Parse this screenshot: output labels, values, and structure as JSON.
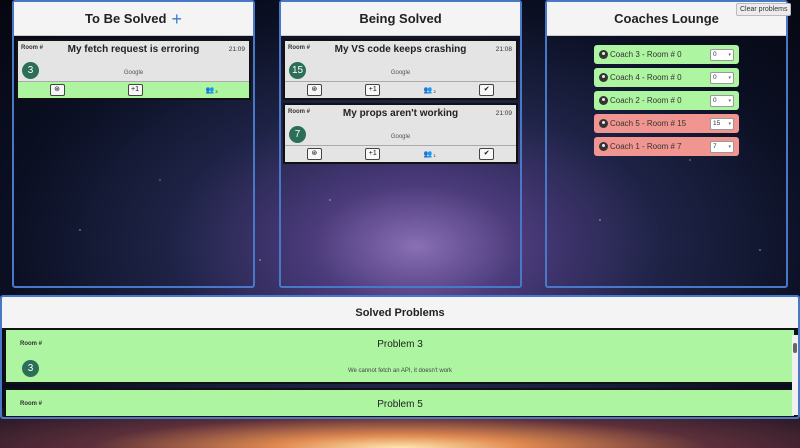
{
  "columns": {
    "to_be_solved": {
      "title": "To Be Solved",
      "add_icon": "plus-icon",
      "cards": [
        {
          "room_label": "Room #",
          "title": "My fetch request is erroring",
          "time": "21:09",
          "room": "3",
          "company": "Google",
          "actions": {
            "help_icon": "lifebuoy-icon",
            "plus_one": "+1",
            "group_icon": "group-icon",
            "count": "3"
          }
        }
      ]
    },
    "being_solved": {
      "title": "Being Solved",
      "cards": [
        {
          "room_label": "Room #",
          "title": "My VS code keeps crashing",
          "time": "21:08",
          "room": "15",
          "company": "Google",
          "actions": {
            "help_icon": "lifebuoy-icon",
            "plus_one": "+1",
            "group_icon": "group-icon",
            "count": "2",
            "done_icon": "checkmark-icon"
          }
        },
        {
          "room_label": "Room #",
          "title": "My props aren't working",
          "time": "21:09",
          "room": "7",
          "company": "Google",
          "actions": {
            "help_icon": "lifebuoy-icon",
            "plus_one": "+1",
            "group_icon": "group-icon",
            "count": "1",
            "done_icon": "checkmark-icon"
          }
        }
      ]
    },
    "coaches_lounge": {
      "title": "Coaches Lounge",
      "clear_label": "Clear problems",
      "coaches": [
        {
          "label": "Coach 3 - Room # 0",
          "selected": "0",
          "status": "available",
          "color": "#adf5a0"
        },
        {
          "label": "Coach 4 - Room # 0",
          "selected": "0",
          "status": "available",
          "color": "#adf5a0"
        },
        {
          "label": "Coach 2 - Room # 0",
          "selected": "0",
          "status": "available",
          "color": "#adf5a0"
        },
        {
          "label": "Coach 5 - Room # 15",
          "selected": "15",
          "status": "busy",
          "color": "#f0958f"
        },
        {
          "label": "Coach 1 - Room # 7",
          "selected": "7",
          "status": "busy",
          "color": "#f0958f"
        }
      ]
    }
  },
  "solved": {
    "title": "Solved Problems",
    "items": [
      {
        "room_label": "Room #",
        "title": "Problem 3",
        "room": "3",
        "description": "We cannot fetch an API, it doesn't work"
      },
      {
        "room_label": "Room #",
        "title": "Problem 5"
      }
    ]
  },
  "colors": {
    "accent": "#4a78c8",
    "available": "#adf5a0",
    "busy": "#f0958f",
    "badge": "#2c6e58"
  }
}
